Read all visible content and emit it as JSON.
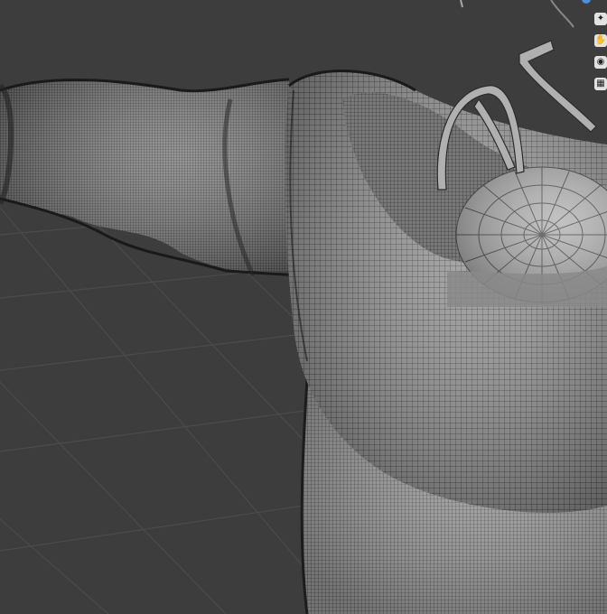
{
  "app": "3D viewport",
  "viewport": {
    "mode": "wireframe",
    "object": "sweater-mesh",
    "background_color": "#3d3d3d",
    "grid_color": "#4a4a4a",
    "mesh_fill_color": "#8f8f8f",
    "wire_color": "#2a2a2a"
  },
  "nav_gizmo": {
    "buttons": [
      {
        "icon": "gizmo-axis-dot"
      },
      {
        "icon": "zoom-icon"
      },
      {
        "icon": "move-view-icon"
      },
      {
        "icon": "camera-icon"
      },
      {
        "icon": "orthographic-toggle-icon"
      }
    ],
    "accent": "#4a8fe0"
  }
}
